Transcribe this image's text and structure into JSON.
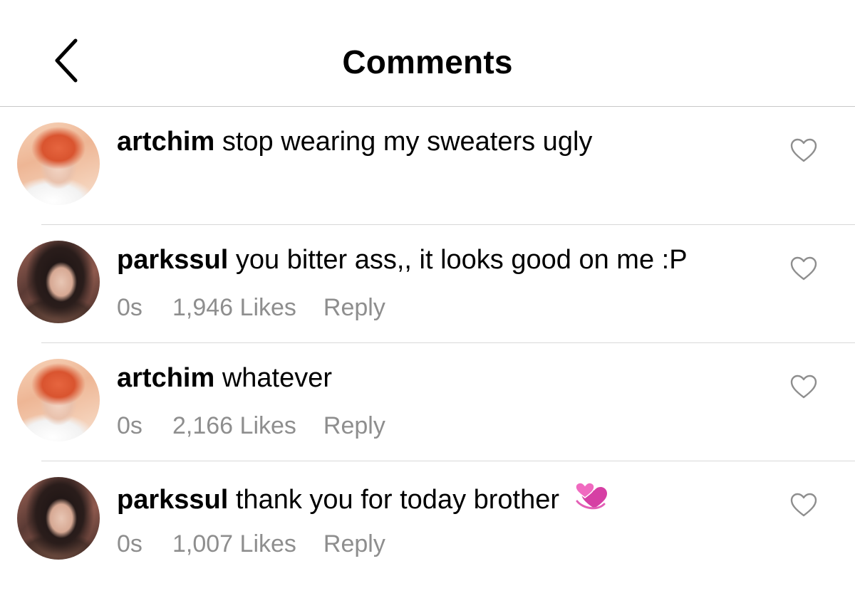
{
  "header": {
    "title": "Comments",
    "back_icon": "chevron-left-icon"
  },
  "comments": [
    {
      "avatar": "red-hair-avatar",
      "username": "artchim",
      "text": "stop wearing my sweaters ugly",
      "time": "",
      "likes": "",
      "reply": "",
      "emoji": ""
    },
    {
      "avatar": "dark-hair-avatar",
      "username": "parkssul",
      "text": "you bitter ass,, it looks good on me :P",
      "time": "0s",
      "likes": "1,946 Likes",
      "reply": "Reply",
      "emoji": ""
    },
    {
      "avatar": "red-hair-avatar",
      "username": "artchim",
      "text": "whatever",
      "time": "0s",
      "likes": "2,166 Likes",
      "reply": "Reply",
      "emoji": ""
    },
    {
      "avatar": "dark-hair-avatar",
      "username": "parkssul",
      "text": "thank you for today brother",
      "time": "0s",
      "likes": "1,007 Likes",
      "reply": "Reply",
      "emoji": "revolving-hearts"
    }
  ],
  "colors": {
    "meta_text": "#8e8e8e",
    "divider": "#d8d8d8",
    "heart_outline": "#8e8e8e"
  }
}
